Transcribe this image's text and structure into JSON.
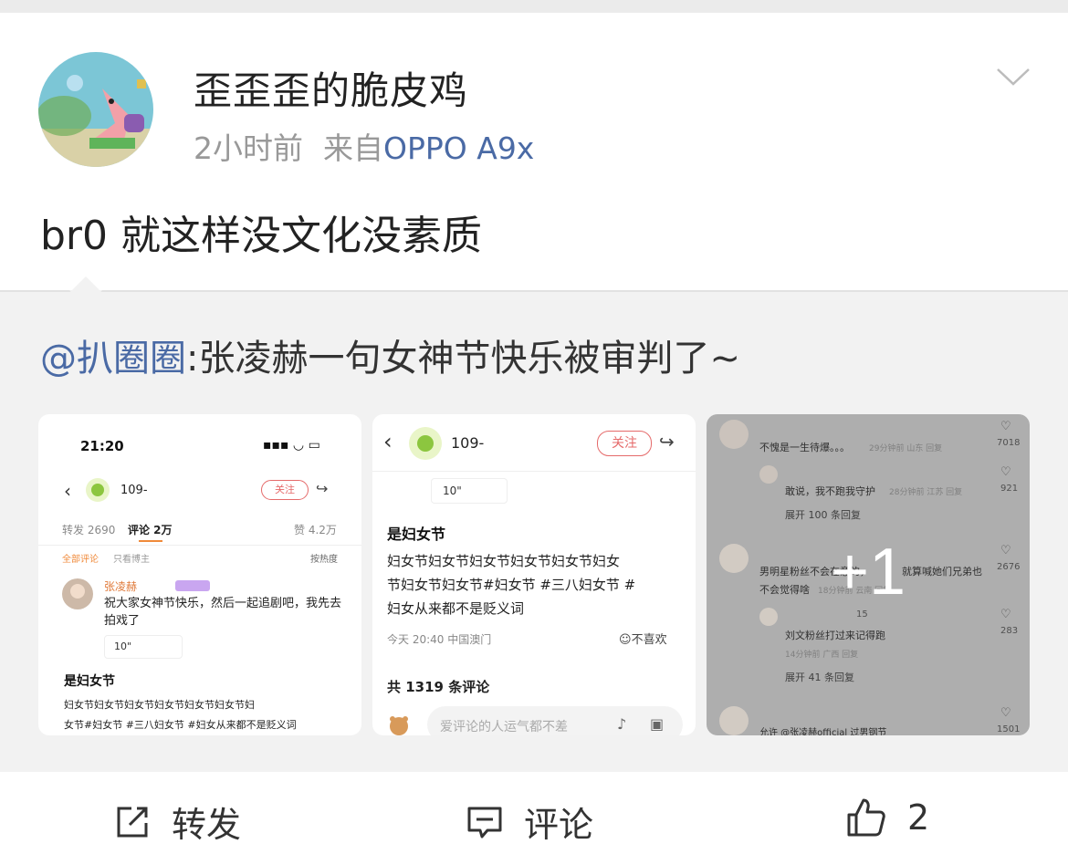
{
  "post": {
    "username": "歪歪歪的脆皮鸡",
    "time": "2小时前",
    "source_prefix": "来自",
    "device": "OPPO A9x",
    "text": "br0 就这样没文化没素质"
  },
  "repost": {
    "author": "@扒圈圈",
    "text": ":张凌赫一句女神节快乐被审判了~"
  },
  "thumb1": {
    "clock": "21:20",
    "name": "109-",
    "follow": "关注",
    "repost_count": "转发 2690",
    "comment_tab": "评论 2万",
    "likes": "赞 4.2万",
    "all_comments": "全部评论",
    "only_owner": "只看博主",
    "sort": "按热度",
    "commenter": "张凌赫",
    "comment": "祝大家女神节快乐，然后一起追剧吧，我先去拍戏了",
    "voice": "10\"",
    "heading": "是妇女节",
    "line1": "妇女节妇女节妇女节妇女节妇女节妇女节妇",
    "line2": "女节#妇女节 #三八妇女节 #妇女从来都不是贬义词"
  },
  "thumb2": {
    "name": "109-",
    "follow": "关注",
    "voice": "10\"",
    "heading": "是妇女节",
    "line1": "妇女节妇女节妇女节妇女节妇女节妇女",
    "line2": "节妇女节妇女节#妇女节 #三八妇女节 #",
    "line3": "妇女从来都不是贬义词",
    "date": "今天 20:40 中国澳门",
    "dislike": "不喜欢",
    "comment_count": "共 1319 条评论",
    "input_placeholder": "爱评论的人运气都不差"
  },
  "thumb3": {
    "c1": "不愧是一生待爆。。。",
    "c1_meta": "29分钟前 山东 回复",
    "c1_likes": "7018",
    "c2": "敢说，我不跑我守护",
    "c2_meta": "28分钟前 江苏 回复",
    "c2_likes": "921",
    "expand1": "展开 100 条回复",
    "c3a": "男明星粉丝不会在意的，",
    "c3b": "就算喊她们兄弟也",
    "c3c": "不会觉得啥",
    "c3_meta": "18分钟前 云南 回复",
    "c3_likes": "2676",
    "c4_name": "15",
    "c4": "刘文粉丝打过来记得跑",
    "c4_meta": "14分钟前 广西 回复",
    "c4_likes": "283",
    "expand2": "展开 41 条回复",
    "c5": "允许 @张凌赫official 过男钢节",
    "c5_likes": "1501",
    "more": "+1"
  },
  "actions": {
    "repost": "转发",
    "comment": "评论",
    "like_count": "2"
  }
}
